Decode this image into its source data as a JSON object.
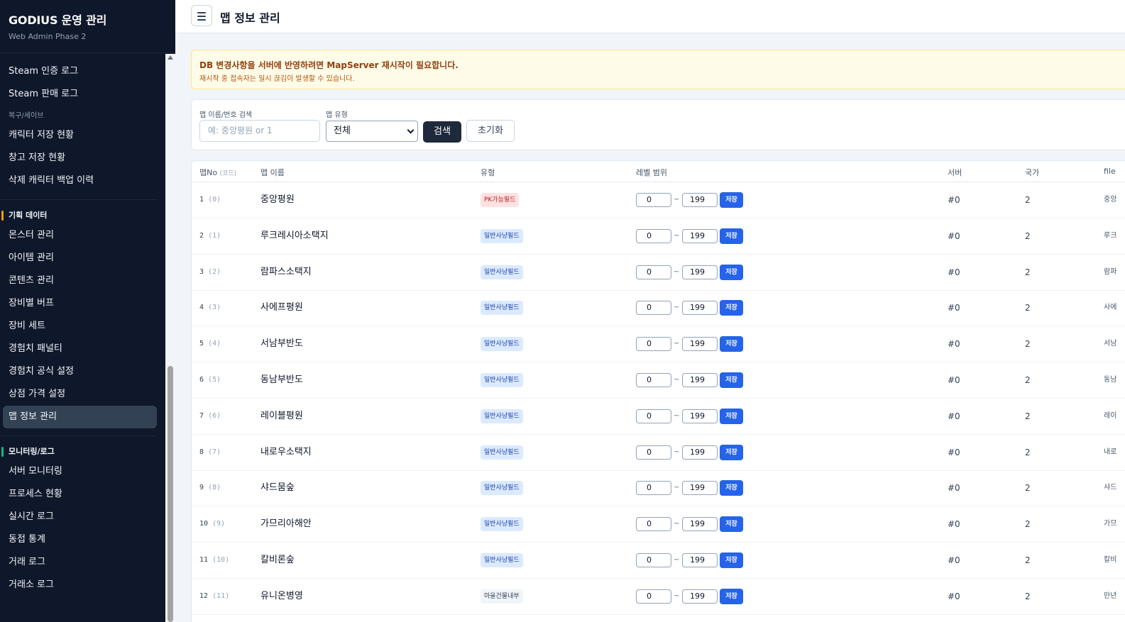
{
  "brand": {
    "title": "GODIUS 운영 관리",
    "subtitle": "Web Admin Phase 2"
  },
  "sidebar": {
    "items_top": [
      "Steam 인증 로그",
      "Steam 판매 로그"
    ],
    "group_backup": {
      "label": "복구/세이브",
      "items": [
        "캐릭터 저장 현황",
        "창고 저장 현황",
        "삭제 캐릭터 백업 이력"
      ]
    },
    "group_planning": {
      "label": "기획 데이터",
      "accent": "#f59e0b",
      "items": [
        "몬스터 관리",
        "아이템 관리",
        "콘텐츠 관리",
        "장비별 버프",
        "장비 세트",
        "경험치 패널티",
        "경험치 공식 설정",
        "상점 가격 설정",
        "맵 정보 관리"
      ]
    },
    "group_monitoring": {
      "label": "모니터링/로그",
      "accent": "#10b981",
      "items": [
        "서버 모니터링",
        "프로세스 현황",
        "실시간 로그",
        "동접 통계",
        "거래 로그",
        "거래소 로그"
      ]
    }
  },
  "header": {
    "title": "맵 정보 관리",
    "menu_icon": "hamburger-icon"
  },
  "alert": {
    "title": "DB 변경사항을 서버에 반영하려면 MapServer 재시작이 필요합니다.",
    "subtitle": "재시작 중 접속자는 일시 끊김이 발생할 수 있습니다."
  },
  "filter": {
    "search_label": "맵 이름/번호 검색",
    "search_placeholder": "예: 중앙평원 or 1",
    "type_label": "맵 유형",
    "type_selected": "전체",
    "search_button": "검색",
    "reset_button": "초기화"
  },
  "table": {
    "headers": {
      "no": "맵No",
      "no_code": "(코드)",
      "name": "맵 이름",
      "type": "유형",
      "level": "레벨 범위",
      "server": "서버",
      "country": "국가",
      "file": "file"
    },
    "save_label": "저장",
    "tilde": "~",
    "rows": [
      {
        "no": "1",
        "code": "(0)",
        "name": "중앙평원",
        "type": "PK가능필드",
        "type_kind": "pk",
        "lv_min": "0",
        "lv_max": "199",
        "server": "#0",
        "country": "2",
        "file": "중앙"
      },
      {
        "no": "2",
        "code": "(1)",
        "name": "루크레시아소택지",
        "type": "일반사냥필드",
        "type_kind": "normal",
        "lv_min": "0",
        "lv_max": "199",
        "server": "#0",
        "country": "2",
        "file": "루크"
      },
      {
        "no": "3",
        "code": "(2)",
        "name": "람파스소택지",
        "type": "일반사냥필드",
        "type_kind": "normal",
        "lv_min": "0",
        "lv_max": "199",
        "server": "#0",
        "country": "2",
        "file": "람파"
      },
      {
        "no": "4",
        "code": "(3)",
        "name": "사에프평원",
        "type": "일반사냥필드",
        "type_kind": "normal",
        "lv_min": "0",
        "lv_max": "199",
        "server": "#0",
        "country": "2",
        "file": "사에"
      },
      {
        "no": "5",
        "code": "(4)",
        "name": "서남부반도",
        "type": "일반사냥필드",
        "type_kind": "normal",
        "lv_min": "0",
        "lv_max": "199",
        "server": "#0",
        "country": "2",
        "file": "서남"
      },
      {
        "no": "6",
        "code": "(5)",
        "name": "동남부반도",
        "type": "일반사냥필드",
        "type_kind": "normal",
        "lv_min": "0",
        "lv_max": "199",
        "server": "#0",
        "country": "2",
        "file": "동남"
      },
      {
        "no": "7",
        "code": "(6)",
        "name": "레이블평원",
        "type": "일반사냥필드",
        "type_kind": "normal",
        "lv_min": "0",
        "lv_max": "199",
        "server": "#0",
        "country": "2",
        "file": "레이"
      },
      {
        "no": "8",
        "code": "(7)",
        "name": "내로우소택지",
        "type": "일반사냥필드",
        "type_kind": "normal",
        "lv_min": "0",
        "lv_max": "199",
        "server": "#0",
        "country": "2",
        "file": "내로"
      },
      {
        "no": "9",
        "code": "(8)",
        "name": "샤드뭄숲",
        "type": "일반사냥필드",
        "type_kind": "normal",
        "lv_min": "0",
        "lv_max": "199",
        "server": "#0",
        "country": "2",
        "file": "샤드"
      },
      {
        "no": "10",
        "code": "(9)",
        "name": "가므리아해안",
        "type": "일반사냥필드",
        "type_kind": "normal",
        "lv_min": "0",
        "lv_max": "199",
        "server": "#0",
        "country": "2",
        "file": "가므"
      },
      {
        "no": "11",
        "code": "(10)",
        "name": "칼비론숲",
        "type": "일반사냥필드",
        "type_kind": "normal",
        "lv_min": "0",
        "lv_max": "199",
        "server": "#0",
        "country": "2",
        "file": "칼비"
      },
      {
        "no": "12",
        "code": "(11)",
        "name": "유니온병영",
        "type": "마을건물내부",
        "type_kind": "town",
        "lv_min": "0",
        "lv_max": "199",
        "server": "#0",
        "country": "2",
        "file": "만년"
      }
    ]
  }
}
